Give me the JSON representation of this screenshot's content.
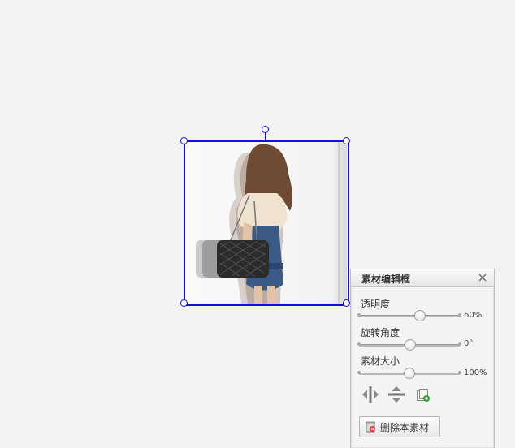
{
  "panel": {
    "title": "素材编辑框",
    "opacity": {
      "label": "透明度",
      "value_text": "60%",
      "fraction": 0.6
    },
    "rotation": {
      "label": "旋转角度",
      "value_text": "0°",
      "fraction": 0.5
    },
    "size": {
      "label": "素材大小",
      "value_text": "100%",
      "fraction": 0.49
    },
    "tools": [
      "flip-horizontal-icon",
      "flip-vertical-icon",
      "copy-icon"
    ],
    "delete_label": "删除本素材"
  },
  "colors": {
    "selection": "#1010e0",
    "panel_bg": "#f4f4f4",
    "canvas_bg": "#f3f3f3"
  }
}
